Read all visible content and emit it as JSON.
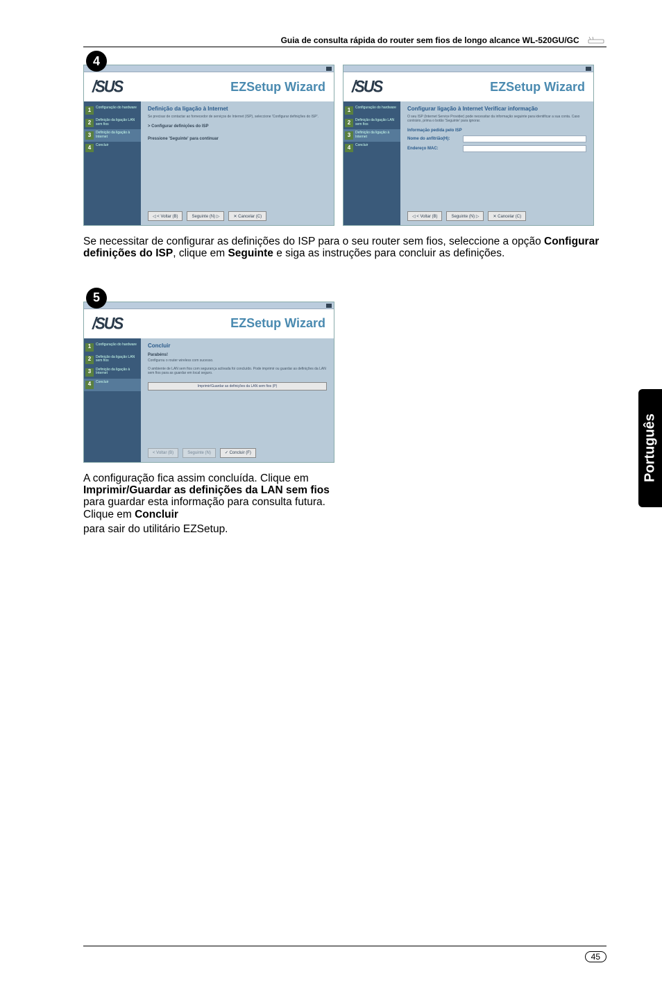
{
  "header": {
    "title": "Guia de consulta rápida do router sem fios de longo alcance WL-520GU/GC"
  },
  "badges": {
    "b4": "4",
    "b5": "5"
  },
  "shot4a": {
    "logo": "/SUS",
    "wizard": "EZSetup Wizard",
    "sidebar": [
      {
        "n": "1",
        "label": "Configuração do hardware"
      },
      {
        "n": "2",
        "label": "Definição da ligação LAN sem fios"
      },
      {
        "n": "3",
        "label": "Definição da ligação à Internet"
      },
      {
        "n": "4",
        "label": "Concluir"
      }
    ],
    "content_title": "Definição da ligação à Internet",
    "content_text": "Se precisar de contactar ao fornecedor de serviços de Internet (ISP), seleccione 'Configurar definições do ISP'.",
    "bullet1": "> Configurar definições do ISP",
    "bullet2": "Pressione 'Seguinte' para continuar",
    "btn_back": "◁ < Voltar (B)",
    "btn_next": "Seguinte (N) ▷",
    "btn_cancel": "✕ Cancelar (C)"
  },
  "shot4b": {
    "logo": "/SUS",
    "wizard": "EZSetup Wizard",
    "sidebar": [
      {
        "n": "1",
        "label": "Configuração do hardware"
      },
      {
        "n": "2",
        "label": "Definição da ligação LAN sem fios"
      },
      {
        "n": "3",
        "label": "Definição da ligação à Internet"
      },
      {
        "n": "4",
        "label": "Concluir"
      }
    ],
    "content_title": "Configurar ligação à Internet Verificar informação",
    "content_text": "O seu ISP (Internet Service Provider) pode necessitar da informação seguinte para identificar a sua conta. Caso contrário, prima o botão 'Seguinte' para ignorar.",
    "row1": "Informação pedida pelo ISP",
    "row2": "Nome do anfitrião(H):",
    "row3": "Endereço MAC:",
    "btn_back": "◁ < Voltar (B)",
    "btn_next": "Seguinte (N) ▷",
    "btn_cancel": "✕ Cancelar (C)"
  },
  "para1": {
    "t1": "Se necessitar de configurar as definições do ISP para o seu router sem fios, seleccione a opção ",
    "b1": "Configurar definições do ISP",
    "t2": ", clique em ",
    "b2": "Seguinte",
    "t3": " e siga as instruções para concluir as definições."
  },
  "shot5": {
    "logo": "/SUS",
    "wizard": "EZSetup Wizard",
    "sidebar": [
      {
        "n": "1",
        "label": "Configuração do hardware"
      },
      {
        "n": "2",
        "label": "Definição da ligação LAN sem fios"
      },
      {
        "n": "3",
        "label": "Definição da ligação à Internet"
      },
      {
        "n": "4",
        "label": "Concluir"
      }
    ],
    "content_title": "Concluir",
    "p1": "Parabéns!",
    "p2": "Configurou o router wireless com sucesso.",
    "p3": "O ambiente de LAN sem fios com segurança activada foi concluído. Pode imprimir ou guardar as definições da LAN sem fios para as guardar em local seguro.",
    "big_btn": "Imprimir/Guardar as definições da LAN sem fios (P)",
    "btn_back": "< Voltar (B)",
    "btn_next": "Seguinte (N)",
    "btn_finish": "✓ Concluir (F)"
  },
  "para2": {
    "t1": "A configuração fica assim concluída. Clique em ",
    "b1": "Imprimir/Guardar as definições da LAN sem fios",
    "t2": " para guardar esta informação para consulta futura. Clique em ",
    "b2": "Concluir",
    "t3": " para sair do utilitário EZSetup."
  },
  "side_tab": "Português",
  "page_num": "45"
}
